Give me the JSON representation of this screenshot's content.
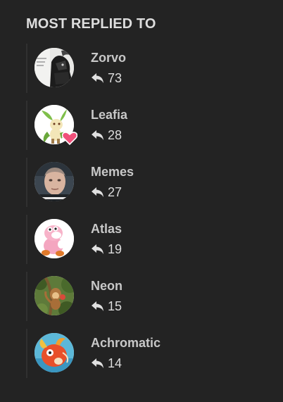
{
  "widget": {
    "title": "MOST REPLIED TO"
  },
  "colors": {
    "background": "#232323",
    "title": "#dddddd",
    "username": "#c8c8c8",
    "count": "#dddddd",
    "divider": "#303030",
    "heart": "#f0507a"
  },
  "users": [
    {
      "name": "Zorvo",
      "replies": "73",
      "avatar": "dark-character-art"
    },
    {
      "name": "Leafia",
      "replies": "28",
      "avatar": "leafeon-with-heart"
    },
    {
      "name": "Memes",
      "replies": "27",
      "avatar": "portrait-photo"
    },
    {
      "name": "Atlas",
      "replies": "19",
      "avatar": "pink-yoshi-plush"
    },
    {
      "name": "Neon",
      "replies": "15",
      "avatar": "monkey-in-jungle"
    },
    {
      "name": "Achromatic",
      "replies": "14",
      "avatar": "magikarp"
    }
  ]
}
